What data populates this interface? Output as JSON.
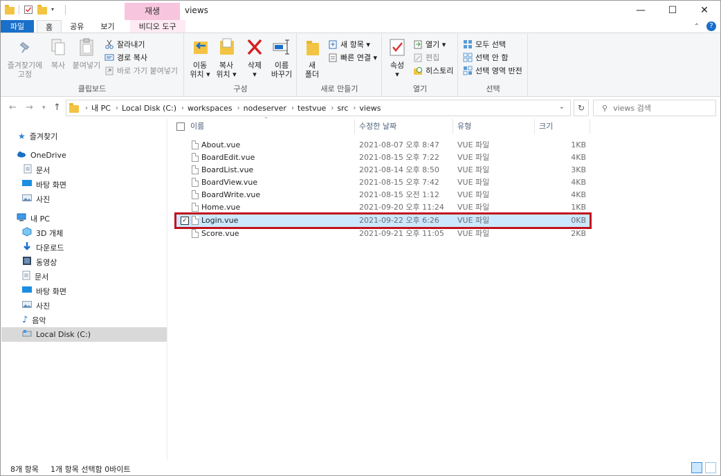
{
  "window": {
    "title": "views",
    "context_tab_header": "재생",
    "controls": {
      "minimize": "—",
      "maximize": "☐",
      "close": "✕"
    }
  },
  "ribbon_tabs": [
    {
      "label": "파일",
      "active": false
    },
    {
      "label": "홈",
      "active": true
    },
    {
      "label": "공유",
      "active": false
    },
    {
      "label": "보기",
      "active": false
    },
    {
      "label": "비디오 도구",
      "active": false
    }
  ],
  "ribbon": {
    "clipboard": {
      "label": "클립보드",
      "pin": "즐겨찾기에\n고정",
      "pin_line1": "즐겨찾기에",
      "pin_line2": "고정",
      "copy": "복사",
      "paste": "붙여넣기",
      "cut": "잘라내기",
      "copy_path": "경로 복사",
      "paste_shortcut": "바로 가기 붙여넣기"
    },
    "organize": {
      "label": "구성",
      "move_to_1": "이동",
      "move_to_2": "위치 ▾",
      "copy_to_1": "복사",
      "copy_to_2": "위치 ▾",
      "delete_1": "삭제",
      "delete_2": "▾",
      "rename_1": "이름",
      "rename_2": "바꾸기"
    },
    "new": {
      "label": "새로 만들기",
      "new_folder_1": "새",
      "new_folder_2": "폴더",
      "new_item": "새 항목 ▾",
      "easy_access": "빠른 연결 ▾"
    },
    "open": {
      "label": "열기",
      "properties_1": "속성",
      "properties_2": "▾",
      "open": "열기 ▾",
      "edit": "편집",
      "history": "히스토리"
    },
    "select": {
      "label": "선택",
      "select_all": "모두 선택",
      "select_none": "선택 안 함",
      "invert": "선택 영역 반전"
    }
  },
  "address": {
    "crumbs": [
      "내 PC",
      "Local Disk (C:)",
      "workspaces",
      "nodeserver",
      "testvue",
      "src",
      "views"
    ],
    "search_placeholder": "views 검색"
  },
  "nav_pane": [
    {
      "label": "즐겨찾기",
      "icon": "star-icon",
      "indent": 0
    },
    {
      "label": "OneDrive",
      "icon": "cloud-icon",
      "indent": 0
    },
    {
      "label": "문서",
      "icon": "document-icon",
      "indent": 1
    },
    {
      "label": "바탕 화면",
      "icon": "desktop-icon",
      "indent": 1
    },
    {
      "label": "사진",
      "icon": "picture-icon",
      "indent": 1
    },
    {
      "label": "내 PC",
      "icon": "computer-icon",
      "indent": 0
    },
    {
      "label": "3D 개체",
      "icon": "cube-icon",
      "indent": 1
    },
    {
      "label": "다운로드",
      "icon": "download-icon",
      "indent": 1
    },
    {
      "label": "동영상",
      "icon": "video-icon",
      "indent": 1
    },
    {
      "label": "문서",
      "icon": "document-icon",
      "indent": 1
    },
    {
      "label": "바탕 화면",
      "icon": "desktop-icon",
      "indent": 1
    },
    {
      "label": "사진",
      "icon": "picture-icon",
      "indent": 1
    },
    {
      "label": "음악",
      "icon": "music-icon",
      "indent": 1
    },
    {
      "label": "Local Disk (C:)",
      "icon": "drive-icon",
      "indent": 1,
      "selected": true
    }
  ],
  "columns": {
    "name": "이름",
    "date": "수정한 날짜",
    "type": "유형",
    "size": "크기"
  },
  "files": [
    {
      "name": "About.vue",
      "date": "2021-08-07 오후 8:47",
      "type": "VUE 파일",
      "size": "1KB",
      "selected": false
    },
    {
      "name": "BoardEdit.vue",
      "date": "2021-08-15 오후 7:22",
      "type": "VUE 파일",
      "size": "4KB",
      "selected": false
    },
    {
      "name": "BoardList.vue",
      "date": "2021-08-14 오후 8:50",
      "type": "VUE 파일",
      "size": "3KB",
      "selected": false
    },
    {
      "name": "BoardView.vue",
      "date": "2021-08-15 오후 7:42",
      "type": "VUE 파일",
      "size": "4KB",
      "selected": false
    },
    {
      "name": "BoardWrite.vue",
      "date": "2021-08-15 오전 1:12",
      "type": "VUE 파일",
      "size": "4KB",
      "selected": false
    },
    {
      "name": "Home.vue",
      "date": "2021-09-20 오후 11:24",
      "type": "VUE 파일",
      "size": "1KB",
      "selected": false
    },
    {
      "name": "Login.vue",
      "date": "2021-09-22 오후 6:26",
      "type": "VUE 파일",
      "size": "0KB",
      "selected": true
    },
    {
      "name": "Score.vue",
      "date": "2021-09-21 오후 11:05",
      "type": "VUE 파일",
      "size": "2KB",
      "selected": false
    }
  ],
  "status": {
    "item_count": "8개 항목",
    "selection": "1개 항목 선택함 0바이트"
  },
  "colors": {
    "accent": "#1a6fc9",
    "context_tab": "#f8c5de",
    "selected_row": "#cce8ff",
    "highlight_border": "#c0121b"
  }
}
